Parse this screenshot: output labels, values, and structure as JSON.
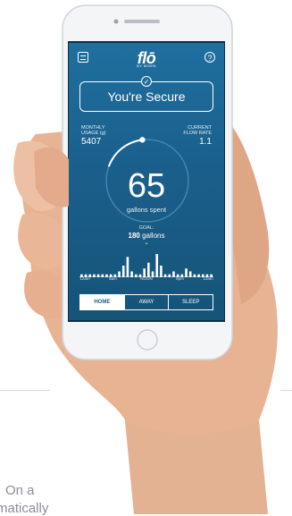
{
  "app": {
    "logo": "flō",
    "logo_sub": "BY MOEN"
  },
  "status": {
    "label": "You're Secure"
  },
  "stats": {
    "monthly": {
      "label_line1": "MONTHLY",
      "label_line2": "USAGE (g)",
      "value": "5407"
    },
    "flow": {
      "label_line1": "CURRENT",
      "label_line2": "FLOW RATE",
      "value": "1.1"
    }
  },
  "gauge": {
    "value": "65",
    "label": "gallons spent",
    "progress_fraction": 0.18
  },
  "goal": {
    "label": "GOAL:",
    "value_number": "180",
    "value_unit": "gallons"
  },
  "chart_data": {
    "type": "bar",
    "x_ticks": [
      "12am",
      "6am",
      "NOON",
      "6pm",
      "12am"
    ],
    "values": [
      1,
      1,
      1,
      1,
      1,
      1,
      1,
      1,
      1,
      2,
      4,
      7,
      2,
      1,
      1,
      3,
      5,
      2,
      8,
      4,
      1,
      1,
      2,
      1,
      1,
      3,
      2,
      1,
      1,
      1,
      1,
      1
    ]
  },
  "modes": {
    "home": "HOME",
    "away": "AWAY",
    "sleep": "SLEEP"
  },
  "bottom": {
    "line1": "On a",
    "line2": "matically"
  },
  "colors": {
    "screen": "#1a5f8c",
    "skin": "#e8b393"
  }
}
